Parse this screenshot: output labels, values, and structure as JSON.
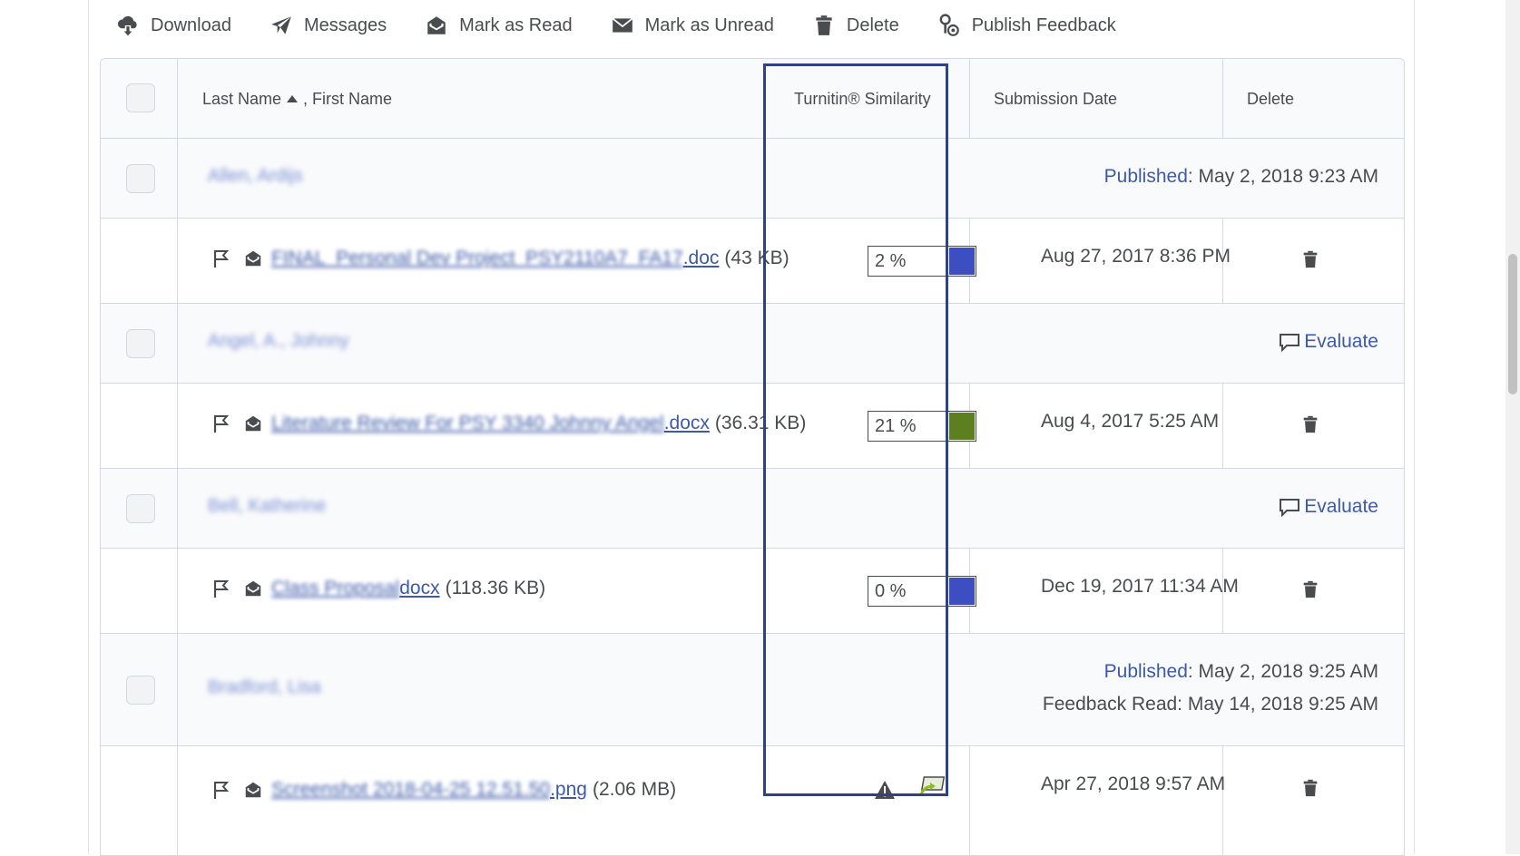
{
  "toolbar": {
    "download": "Download",
    "messages": "Messages",
    "mark_read": "Mark as Read",
    "mark_unread": "Mark as Unread",
    "delete": "Delete",
    "publish_feedback": "Publish Feedback"
  },
  "header": {
    "last_name": "Last Name",
    "first_name": ", First Name",
    "similarity": "Turnitin® Similarity",
    "submission_date": "Submission Date",
    "delete": "Delete"
  },
  "students": [
    {
      "name": "Allen, Ardijs",
      "status_link": "Published",
      "status_text": ": May 2, 2018 9:23 AM",
      "file_name": "FINAL_Personal Dev Project_PSY2110A7_FA17",
      "file_ext": ".doc",
      "file_size": "(43 KB)",
      "similarity": "2 %",
      "similarity_color": "#3d4ec2",
      "date": "Aug 27, 2017 8:36 PM"
    },
    {
      "name": "Angel, A., Johnny",
      "evaluate": "Evaluate",
      "file_name": "Literature Review For PSY 3340 Johnny Angel",
      "file_ext": ".docx",
      "file_size": "(36.31 KB)",
      "similarity": "21 %",
      "similarity_color": "#5e7f20",
      "date": "Aug 4, 2017 5:25 AM"
    },
    {
      "name": "Bell, Katherine",
      "evaluate": "Evaluate",
      "file_name": "Class Proposal",
      "file_ext": "docx",
      "file_size": "(118.36 KB)",
      "similarity": "0 %",
      "similarity_color": "#3d4ec2",
      "date": "Dec 19, 2017 11:34 AM"
    },
    {
      "name": "Bradford, Lisa",
      "status_link": "Published",
      "status_text": ": May 2, 2018 9:25 AM",
      "status_line2": "Feedback Read: May 14, 2018 9:25 AM",
      "file_name": "Screenshot 2018-04-25 12.51.50",
      "file_ext": ".png",
      "file_size": "(2.06 MB)",
      "date": "Apr 27, 2018 9:57 AM"
    }
  ],
  "icons": [
    "download-icon",
    "messages-icon",
    "mark-read-icon",
    "mark-unread-icon",
    "trash-icon",
    "publish-feedback-icon",
    "flag-icon",
    "read-envelope-icon",
    "evaluate-speech-icon",
    "warning-icon",
    "resubmit-icon"
  ]
}
